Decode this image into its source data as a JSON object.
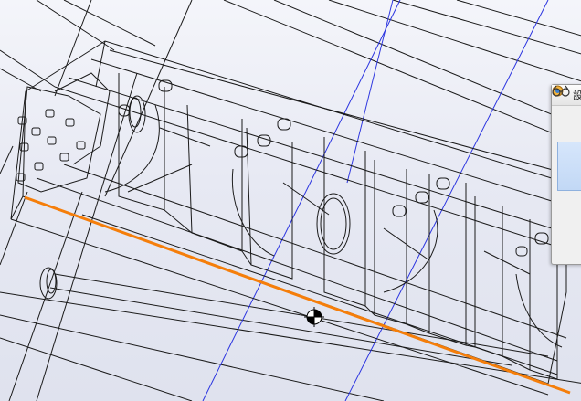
{
  "viewport": {
    "background_top": "#f4f5fa",
    "background_bottom": "#dfe2ee",
    "wire_color": "#1a1a1a",
    "sketch_line_color": "#2b34e0",
    "selected_edge_color": "#f57e0a",
    "origin_icon": "origin-marker-icon"
  },
  "side_panel": {
    "title": "設",
    "app_icon": "solidworks-panel-icon",
    "tool_icon": "glasses-icon"
  }
}
